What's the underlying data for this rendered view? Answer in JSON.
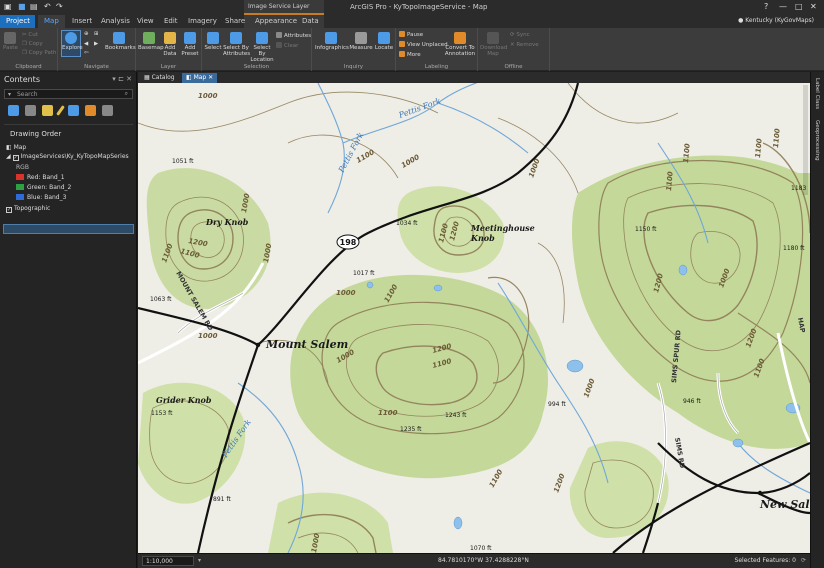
{
  "app": {
    "title": "ArcGIS Pro - KyTopoImageService - Map",
    "context_label": "Image Service Layer",
    "user": "Kentucky (KyGovMaps)"
  },
  "tabs": [
    "Project",
    "Map",
    "Insert",
    "Analysis",
    "View",
    "Edit",
    "Imagery",
    "Share",
    "Appearance",
    "Data"
  ],
  "ribbon": {
    "clipboard": {
      "label": "Clipboard",
      "paste": "Paste",
      "cut": "Cut",
      "copy": "Copy",
      "copy_path": "Copy Path"
    },
    "navigate": {
      "label": "Navigate",
      "explore": "Explore",
      "bookmarks": "Bookmarks"
    },
    "layer": {
      "label": "Layer",
      "basemap": "Basemap",
      "add_data": "Add Data",
      "add_preset": "Add Preset"
    },
    "selection": {
      "label": "Selection",
      "select": "Select",
      "by_attributes": "Select By Attributes",
      "by_location": "Select By Location",
      "attributes": "Attributes",
      "clear": "Clear"
    },
    "inquiry": {
      "label": "Inquiry",
      "infographics": "Infographics",
      "measure": "Measure",
      "locate": "Locate"
    },
    "labeling": {
      "label": "Labeling",
      "pause": "Pause",
      "view_unplaced": "View Unplaced",
      "more": "More",
      "convert": "Convert To Annotation"
    },
    "offline": {
      "label": "Offline",
      "download": "Download Map",
      "sync": "Sync",
      "remove": "Remove"
    }
  },
  "contents": {
    "title": "Contents",
    "search_placeholder": "Search",
    "drawing_order": "Drawing Order",
    "map_item": "Map",
    "layer": "ImageServices\\Ky_KyTopoMapSeries",
    "rgb": "RGB",
    "bands": [
      {
        "label": "Red: Band_1",
        "color": "#d9342b"
      },
      {
        "label": "Green: Band_2",
        "color": "#2ea043"
      },
      {
        "label": "Blue: Band_3",
        "color": "#2f6bd6"
      }
    ],
    "basemap": "Topographic"
  },
  "view_tabs": [
    "Catalog",
    "Map"
  ],
  "map_labels": {
    "places": [
      "Mount Salem",
      "New Salem",
      "Dry Knob",
      "Meetinghouse",
      "Knob",
      "Grider Knob"
    ],
    "streams": [
      "Pettis Fork",
      "Pettis Fork",
      "Pettis Fork"
    ],
    "roads": [
      "MOUNT SALEM RD",
      "SIMS SPUR RD",
      "SIMS RD",
      "HAP"
    ],
    "route_shield": "198",
    "spot_heights": [
      "1051 ft",
      "1034 ft",
      "1017 ft",
      "1063 ft",
      "1153 ft",
      "1235 ft",
      "1243 ft",
      "994 ft",
      "1150 ft",
      "1180 ft",
      "1183",
      "946 ft",
      "891 ft",
      "1070 ft"
    ],
    "contours": [
      "1000",
      "1000",
      "1100",
      "1200",
      "1100",
      "1100",
      "1000",
      "1100",
      "1200",
      "1100",
      "1200",
      "1100",
      "1000",
      "1100",
      "1100",
      "1100",
      "1100",
      "1100",
      "1200",
      "1000",
      "1000",
      "1000",
      "1000",
      "1100",
      "1200",
      "1100",
      "1000",
      "1000",
      "1200",
      "1000"
    ]
  },
  "status": {
    "scale": "1:10,000",
    "coords": "84.7810170°W 37.4288228°N",
    "selected": "Selected Features: 0"
  },
  "right_pane": [
    "Label Class",
    "Geoprocessing"
  ]
}
